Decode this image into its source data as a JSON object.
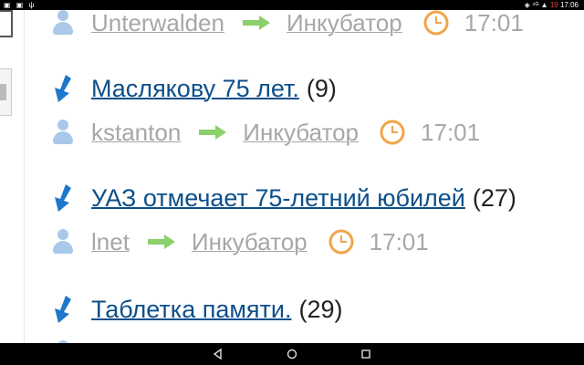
{
  "statusbar": {
    "left_icons": [
      "image-icon",
      "image-icon",
      "usb-icon"
    ],
    "signal": "⁴ᴳ",
    "battery_text": "19",
    "time": "17:06"
  },
  "posts": [
    {
      "title": "",
      "count": "",
      "meta": {
        "user": "Unterwalden",
        "category": "Инкубатор",
        "time": "17:01"
      }
    },
    {
      "title": "Маслякову 75 лет.",
      "count": "(9)",
      "meta": {
        "user": "kstanton",
        "category": "Инкубатор",
        "time": "17:01"
      }
    },
    {
      "title": "УАЗ отмечает 75-летний юбилей",
      "count": "(27)",
      "meta": {
        "user": "lnet",
        "category": "Инкубатор",
        "time": "17:01"
      }
    },
    {
      "title": "Таблетка памяти.",
      "count": "(29)",
      "meta": {
        "user": "",
        "category": "",
        "time": ""
      }
    }
  ],
  "colors": {
    "link": "#0d4f8b",
    "meta_text": "#a7a7a7",
    "arrow_green": "#8bd06a",
    "clock_orange": "#f2a44a",
    "down_arrow_blue": "#1f77c9"
  },
  "navbar": {
    "back": "back-icon",
    "home": "home-icon",
    "recents": "recents-icon"
  }
}
